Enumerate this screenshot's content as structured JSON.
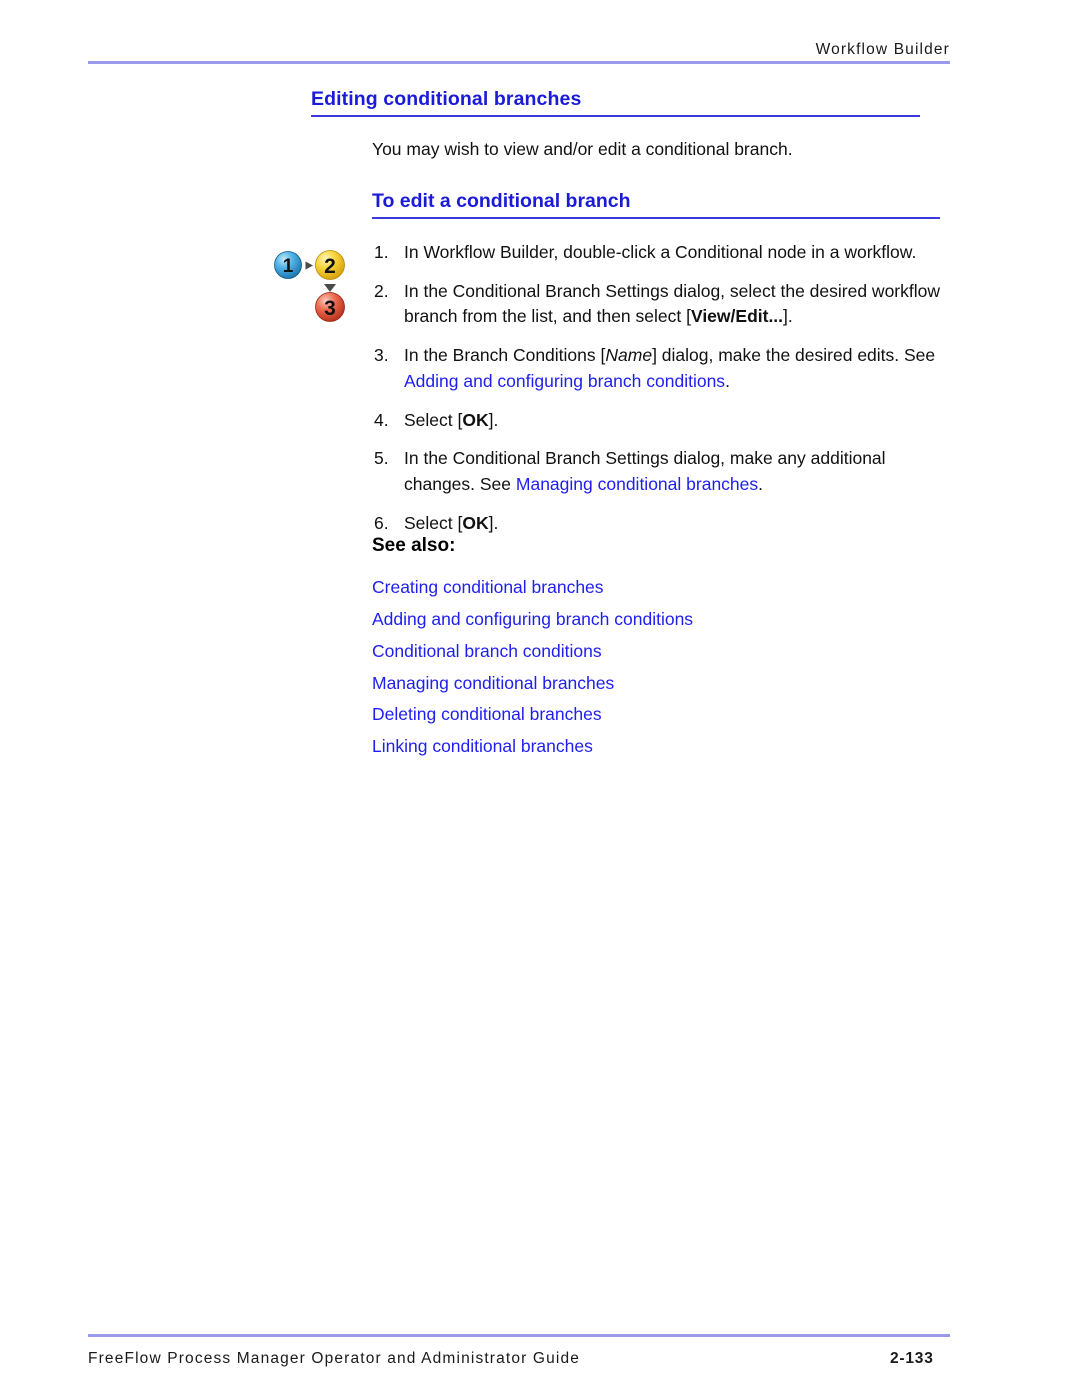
{
  "header": {
    "running_head": "Workflow Builder"
  },
  "h1": {
    "title": "Editing conditional branches"
  },
  "intro": {
    "text": "You may wish to view and/or edit a conditional branch."
  },
  "h2": {
    "title": "To edit a conditional branch"
  },
  "steps_icon": {
    "label": "steps-1-2-3-graphic",
    "nodes": [
      {
        "number": "1",
        "color": "#3aa5dd"
      },
      {
        "number": "2",
        "color": "#f5d22a"
      },
      {
        "number": "3",
        "color": "#e8563c"
      }
    ]
  },
  "procedure": [
    {
      "num": "1.",
      "parts": [
        {
          "type": "text",
          "text": "In Workflow Builder, double-click a Conditional node in a workflow."
        }
      ]
    },
    {
      "num": "2.",
      "parts": [
        {
          "type": "text",
          "text": "In the Conditional Branch Settings dialog, select the desired workflow branch from the list, and then select ["
        },
        {
          "type": "bold",
          "text": "View/Edit..."
        },
        {
          "type": "text",
          "text": "]."
        }
      ]
    },
    {
      "num": "3.",
      "parts": [
        {
          "type": "text",
          "text": "In the Branch Conditions ["
        },
        {
          "type": "italic",
          "text": "Name"
        },
        {
          "type": "text",
          "text": "] dialog, make the desired edits. See "
        },
        {
          "type": "link",
          "text": "Adding and configuring branch conditions"
        },
        {
          "type": "text",
          "text": "."
        }
      ]
    },
    {
      "num": "4.",
      "parts": [
        {
          "type": "text",
          "text": "Select ["
        },
        {
          "type": "bold",
          "text": "OK"
        },
        {
          "type": "text",
          "text": "]."
        }
      ]
    },
    {
      "num": "5.",
      "parts": [
        {
          "type": "text",
          "text": "In the Conditional Branch Settings dialog, make any additional changes. See "
        },
        {
          "type": "link",
          "text": "Managing conditional branches"
        },
        {
          "type": "text",
          "text": "."
        }
      ]
    },
    {
      "num": "6.",
      "parts": [
        {
          "type": "text",
          "text": "Select ["
        },
        {
          "type": "bold",
          "text": "OK"
        },
        {
          "type": "text",
          "text": "]."
        }
      ]
    }
  ],
  "see_also": {
    "title": "See also:",
    "links": [
      "Creating conditional branches",
      "Adding and configuring branch conditions",
      "Conditional branch conditions",
      "Managing conditional branches",
      "Deleting conditional branches",
      "Linking conditional branches"
    ]
  },
  "footer": {
    "guide_title": "FreeFlow Process Manager Operator and Administrator Guide",
    "page_number": "2-133"
  },
  "colors": {
    "heading_blue": "#1a1ad8",
    "link_blue": "#1e1ef0",
    "rule_lavender": "#9a9aea",
    "rule_blue": "#3b3bdd"
  }
}
